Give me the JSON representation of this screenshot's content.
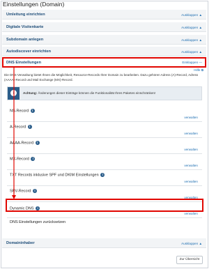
{
  "page": {
    "title": "Einstellungen (Domain)"
  },
  "sections": [
    {
      "label": "Umleitung einrichten",
      "toggle": "Ausklappen"
    },
    {
      "label": "Digitale Visitenkarte",
      "toggle": "Ausklappen"
    },
    {
      "label": "Subdomain anlegen",
      "toggle": "Ausklappen"
    },
    {
      "label": "Autodiscover einrichten",
      "toggle": "Ausklappen"
    },
    {
      "label": "DNS Einstellungen",
      "toggle": "Einklappen"
    }
  ],
  "dns": {
    "help": "Hilfe",
    "description": "Die DNS-Verwaltung bietet Ihnen die Möglichkeit, Resource-Records Ihrer Domain zu bearbeiten. Dazu gehören Adress (A)-Record, Adress (AAAA)-Record und Mail Exchange (MX)-Record.",
    "warning_label": "Achtung:",
    "warning_text": "Änderungen dieser Einträge können die Funktionalität Ihres Paketes einschränken!",
    "records": [
      {
        "name": "NS-Record",
        "action": "verwalten"
      },
      {
        "name": "A-Record",
        "action": "verwalten"
      },
      {
        "name": "AAAA-Record",
        "action": "verwalten"
      },
      {
        "name": "MX-Record",
        "action": "verwalten"
      },
      {
        "name": "TXT Records inklusive SPF und DKIM Einstellungen",
        "action": "verwalten"
      },
      {
        "name": "SRV-Record",
        "action": "verwalten"
      },
      {
        "name": "Dynamic DNS",
        "action": "verwalten"
      },
      {
        "name": "DNS Einstellungen zurücksetzen",
        "action": ""
      }
    ]
  },
  "domain_owner": {
    "label": "Domaininhaber",
    "toggle": "Ausklappen"
  },
  "footer": {
    "overview_button": "Zur Übersicht"
  },
  "colors": {
    "highlight": "#e10600",
    "link": "#1f6fb2",
    "heading": "#1f4e79"
  },
  "icons": {
    "expand": "up-arrow-icon",
    "collapse": "minus-icon",
    "info": "info-icon",
    "external": "external-link-icon"
  }
}
